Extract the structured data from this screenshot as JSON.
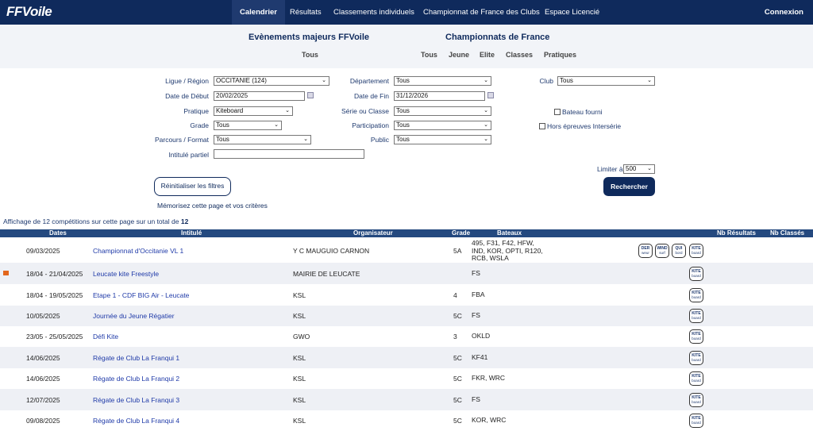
{
  "nav": {
    "logo_text": "FFVoile",
    "items": [
      "Calendrier",
      "Résultats",
      "Classements individuels",
      "Championnat de France des Clubs",
      "Espace Licencié"
    ],
    "login": "Connexion"
  },
  "header": {
    "major_title": "Evènements majeurs FFVoile",
    "major_links": [
      "Tous"
    ],
    "champ_title": "Championnats de France",
    "champ_links": [
      "Tous",
      "Jeune",
      "Elite",
      "Classes",
      "Pratiques"
    ]
  },
  "filters": {
    "ligue_label": "Ligue / Région",
    "ligue_value": "OCCITANIE (124)",
    "dept_label": "Département",
    "dept_value": "Tous",
    "club_label": "Club",
    "club_value": "Tous",
    "date_debut_label": "Date de Début",
    "date_debut_value": "20/02/2025",
    "date_fin_label": "Date de Fin",
    "date_fin_value": "31/12/2026",
    "pratique_label": "Pratique",
    "pratique_value": "Kiteboard",
    "serie_label": "Série ou Classe",
    "serie_value": "Tous",
    "bateau_fourni_label": "Bateau fourni",
    "grade_label": "Grade",
    "grade_value": "Tous",
    "participation_label": "Participation",
    "participation_value": "Tous",
    "hors_epreuves_label": "Hors épreuves Intersérie",
    "parcours_label": "Parcours / Format",
    "parcours_value": "Tous",
    "public_label": "Public",
    "public_value": "Tous",
    "intitule_label": "Intitulé partiel",
    "intitule_value": "",
    "limit_label": "Limiter à",
    "limit_value": "500",
    "reset_label": "Réinitialiser les filtres",
    "search_label": "Rechercher",
    "memo_label": "Mémorisez cette page et vos critères"
  },
  "summary": {
    "text": "Affichage de 12 compétitions sur cette page sur un total de",
    "total": "12"
  },
  "table": {
    "headers": [
      "Dates",
      "Intitulé",
      "Organisateur",
      "Grade",
      "Bateaux",
      "Nb Résultats",
      "Nb Classés"
    ],
    "rows": [
      {
        "dates": "09/03/2025",
        "title": "Championnat d'Occitanie VL 1",
        "org": "Y C MAUGUIO CARNON",
        "grade": "5A",
        "boats": [
          "495, F31, F42, HFW,",
          "IND, KOR, OPTI, R120,",
          "RCB, WSLA"
        ],
        "badges": [
          [
            "DER",
            "weur"
          ],
          [
            "WIND",
            "surf"
          ],
          [
            "QUI",
            "bord"
          ],
          [
            "KITE",
            "board"
          ]
        ],
        "flag": false
      },
      {
        "dates": "18/04 - 21/04/2025",
        "title": "Leucate kite Freestyle",
        "org": "MAIRIE DE LEUCATE",
        "grade": "",
        "boats": [
          "FS"
        ],
        "badges": [
          [
            "KITE",
            "board"
          ]
        ],
        "flag": true
      },
      {
        "dates": "18/04 - 19/05/2025",
        "title": "Etape 1 - CDF BIG Air - Leucate",
        "org": "KSL",
        "grade": "4",
        "boats": [
          "FBA"
        ],
        "badges": [
          [
            "KITE",
            "board"
          ]
        ],
        "flag": false
      },
      {
        "dates": "10/05/2025",
        "title": "Journée du Jeune Régatier",
        "org": "KSL",
        "grade": "5C",
        "boats": [
          "FS"
        ],
        "badges": [
          [
            "KITE",
            "board"
          ]
        ],
        "flag": false
      },
      {
        "dates": "23/05 - 25/05/2025",
        "title": "Défi Kite",
        "org": "GWO",
        "grade": "3",
        "boats": [
          "OKLD"
        ],
        "badges": [
          [
            "KITE",
            "board"
          ]
        ],
        "flag": false
      },
      {
        "dates": "14/06/2025",
        "title": "Régate de Club La Franqui 1",
        "org": "KSL",
        "grade": "5C",
        "boats": [
          "KF41"
        ],
        "badges": [
          [
            "KITE",
            "board"
          ]
        ],
        "flag": false
      },
      {
        "dates": "14/06/2025",
        "title": "Régate de Club La Franqui 2",
        "org": "KSL",
        "grade": "5C",
        "boats": [
          "FKR, WRC"
        ],
        "badges": [
          [
            "KITE",
            "board"
          ]
        ],
        "flag": false
      },
      {
        "dates": "12/07/2025",
        "title": "Régate de Club La Franqui 3",
        "org": "KSL",
        "grade": "5C",
        "boats": [
          "FS"
        ],
        "badges": [
          [
            "KITE",
            "board"
          ]
        ],
        "flag": false
      },
      {
        "dates": "09/08/2025",
        "title": "Régate de Club La Franqui 4",
        "org": "KSL",
        "grade": "5C",
        "boats": [
          "KOR, WRC"
        ],
        "badges": [
          [
            "KITE",
            "board"
          ]
        ],
        "flag": false
      }
    ]
  }
}
